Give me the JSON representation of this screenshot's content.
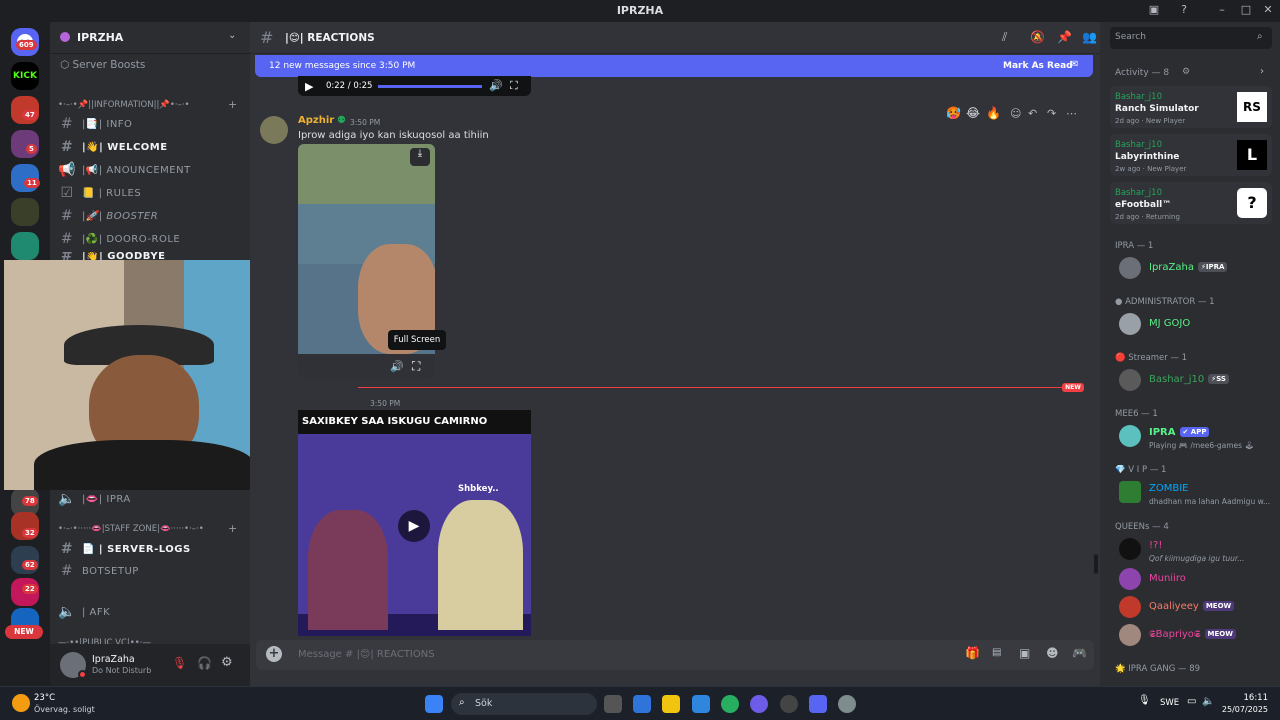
{
  "window": {
    "title": "IPRZHA"
  },
  "server": {
    "name": "IPRZHA",
    "boosts_label": "Server Boosts"
  },
  "rail": {
    "top_badge": "609",
    "badges": [
      "47",
      "5",
      "11",
      "78",
      "32",
      "62",
      "22"
    ],
    "new_label": "NEW"
  },
  "categories": {
    "information": "•·–·•📌||INFORMATION||📌•·–·•",
    "staff": "•·–·•·····👄|STAFF ZONE|👄·····•·–·•",
    "public_vc": "—·••|PUBLIC VC|••·—"
  },
  "channels": [
    {
      "label": "|📑| INFO"
    },
    {
      "label": "|👋| WELCOME"
    },
    {
      "label": "|📢| ANOUNCEMENT"
    },
    {
      "label": "📒 | RULES"
    },
    {
      "label": "|🚀| BOOSTER"
    },
    {
      "label": "|♻️| DOORO-ROLE"
    },
    {
      "label": "|👋| GOODBYE"
    },
    {
      "label": "|👄| IPRA"
    },
    {
      "label": "📄 | SERVER-LOGS"
    },
    {
      "label": "BOTSETUP"
    },
    {
      "label": "| AFK"
    }
  ],
  "user": {
    "name": "IpraZaha",
    "status": "Do Not Disturb"
  },
  "chat": {
    "channel_title": "|😊| REACTIONS",
    "new_messages": "12 new messages since 3:50 PM",
    "mark_read": "Mark As Read",
    "video_time": "0:22 / 0:25",
    "message": {
      "author": "Apzhir",
      "time": "3:50 PM",
      "text": "Iprow adiga iyo kan iskuqosol aa tihiin"
    },
    "tooltip": "Full Screen",
    "new_divider": "NEW",
    "second_time": "3:50 PM",
    "video2_caption": "SAXIBKEY SAA ISKUGU CAMIRNO",
    "video2_tag": "Shbkey..",
    "input_placeholder": "Message # |😊| REACTIONS"
  },
  "search": {
    "placeholder": "Search"
  },
  "activity": {
    "header": "Activity — 8",
    "items": [
      {
        "user": "Bashar_j10",
        "game": "Ranch Simulator",
        "meta": "2d ago",
        "status": "New Player",
        "icon_text": "RS"
      },
      {
        "user": "Bashar_j10",
        "game": "Labyrinthine",
        "meta": "2w ago",
        "status": "New Player",
        "icon_text": "L"
      },
      {
        "user": "Bashar_j10",
        "game": "eFootball™",
        "meta": "2d ago",
        "status": "Returning",
        "icon_text": "?"
      }
    ]
  },
  "member_groups": [
    {
      "title": "IPRA — 1",
      "members": [
        {
          "name": "IpraZaha",
          "tag": "⚡IPRA",
          "color": "#57f287"
        }
      ]
    },
    {
      "title": "● ADMINISTRATOR — 1",
      "members": [
        {
          "name": "MJ GOJO",
          "color": "#57f287"
        }
      ]
    },
    {
      "title": "🔴 Streamer — 1",
      "members": [
        {
          "name": "Bashar_j10",
          "tag": "⚡SS",
          "color": "#3ba55c"
        }
      ]
    },
    {
      "title": "MEE6 — 1",
      "members": [
        {
          "name": "IPRA",
          "tag": "✔ APP",
          "sub": "Playing 🎮 /mee6-games 🕹",
          "color": "#57f287"
        }
      ]
    },
    {
      "title": "💎 V I P — 1",
      "members": [
        {
          "name": "ZOMBIE",
          "sub": "dhadhan ma lahan Aadmigu w...",
          "color": "#00a8fc"
        }
      ]
    },
    {
      "title": "QUEENs — 4",
      "members": [
        {
          "name": "!?!",
          "sub": "Qof kiimugdiga igu tuur...",
          "color": "#eb459e"
        },
        {
          "name": "Muniiro",
          "color": "#eb459e"
        },
        {
          "name": "Qaaliyeey",
          "tag": "MEOW",
          "color": "#f47b67"
        },
        {
          "name": "𝕾Bapriyo𝕾",
          "tag": "MEOW",
          "color": "#eb459e"
        }
      ]
    },
    {
      "title": "🌟 IPRA GANG — 89",
      "members": []
    }
  ],
  "taskbar": {
    "weather_temp": "23°C",
    "weather_text": "Övervag. soligt",
    "search": "Sök",
    "lang": "SWE",
    "time": "16:11",
    "date": "25/07/2025"
  },
  "colors": {
    "accent": "#5865f2",
    "background": "#313338",
    "sidebar": "#2b2d31",
    "online": "#23a55a",
    "dnd": "#f23f43"
  }
}
